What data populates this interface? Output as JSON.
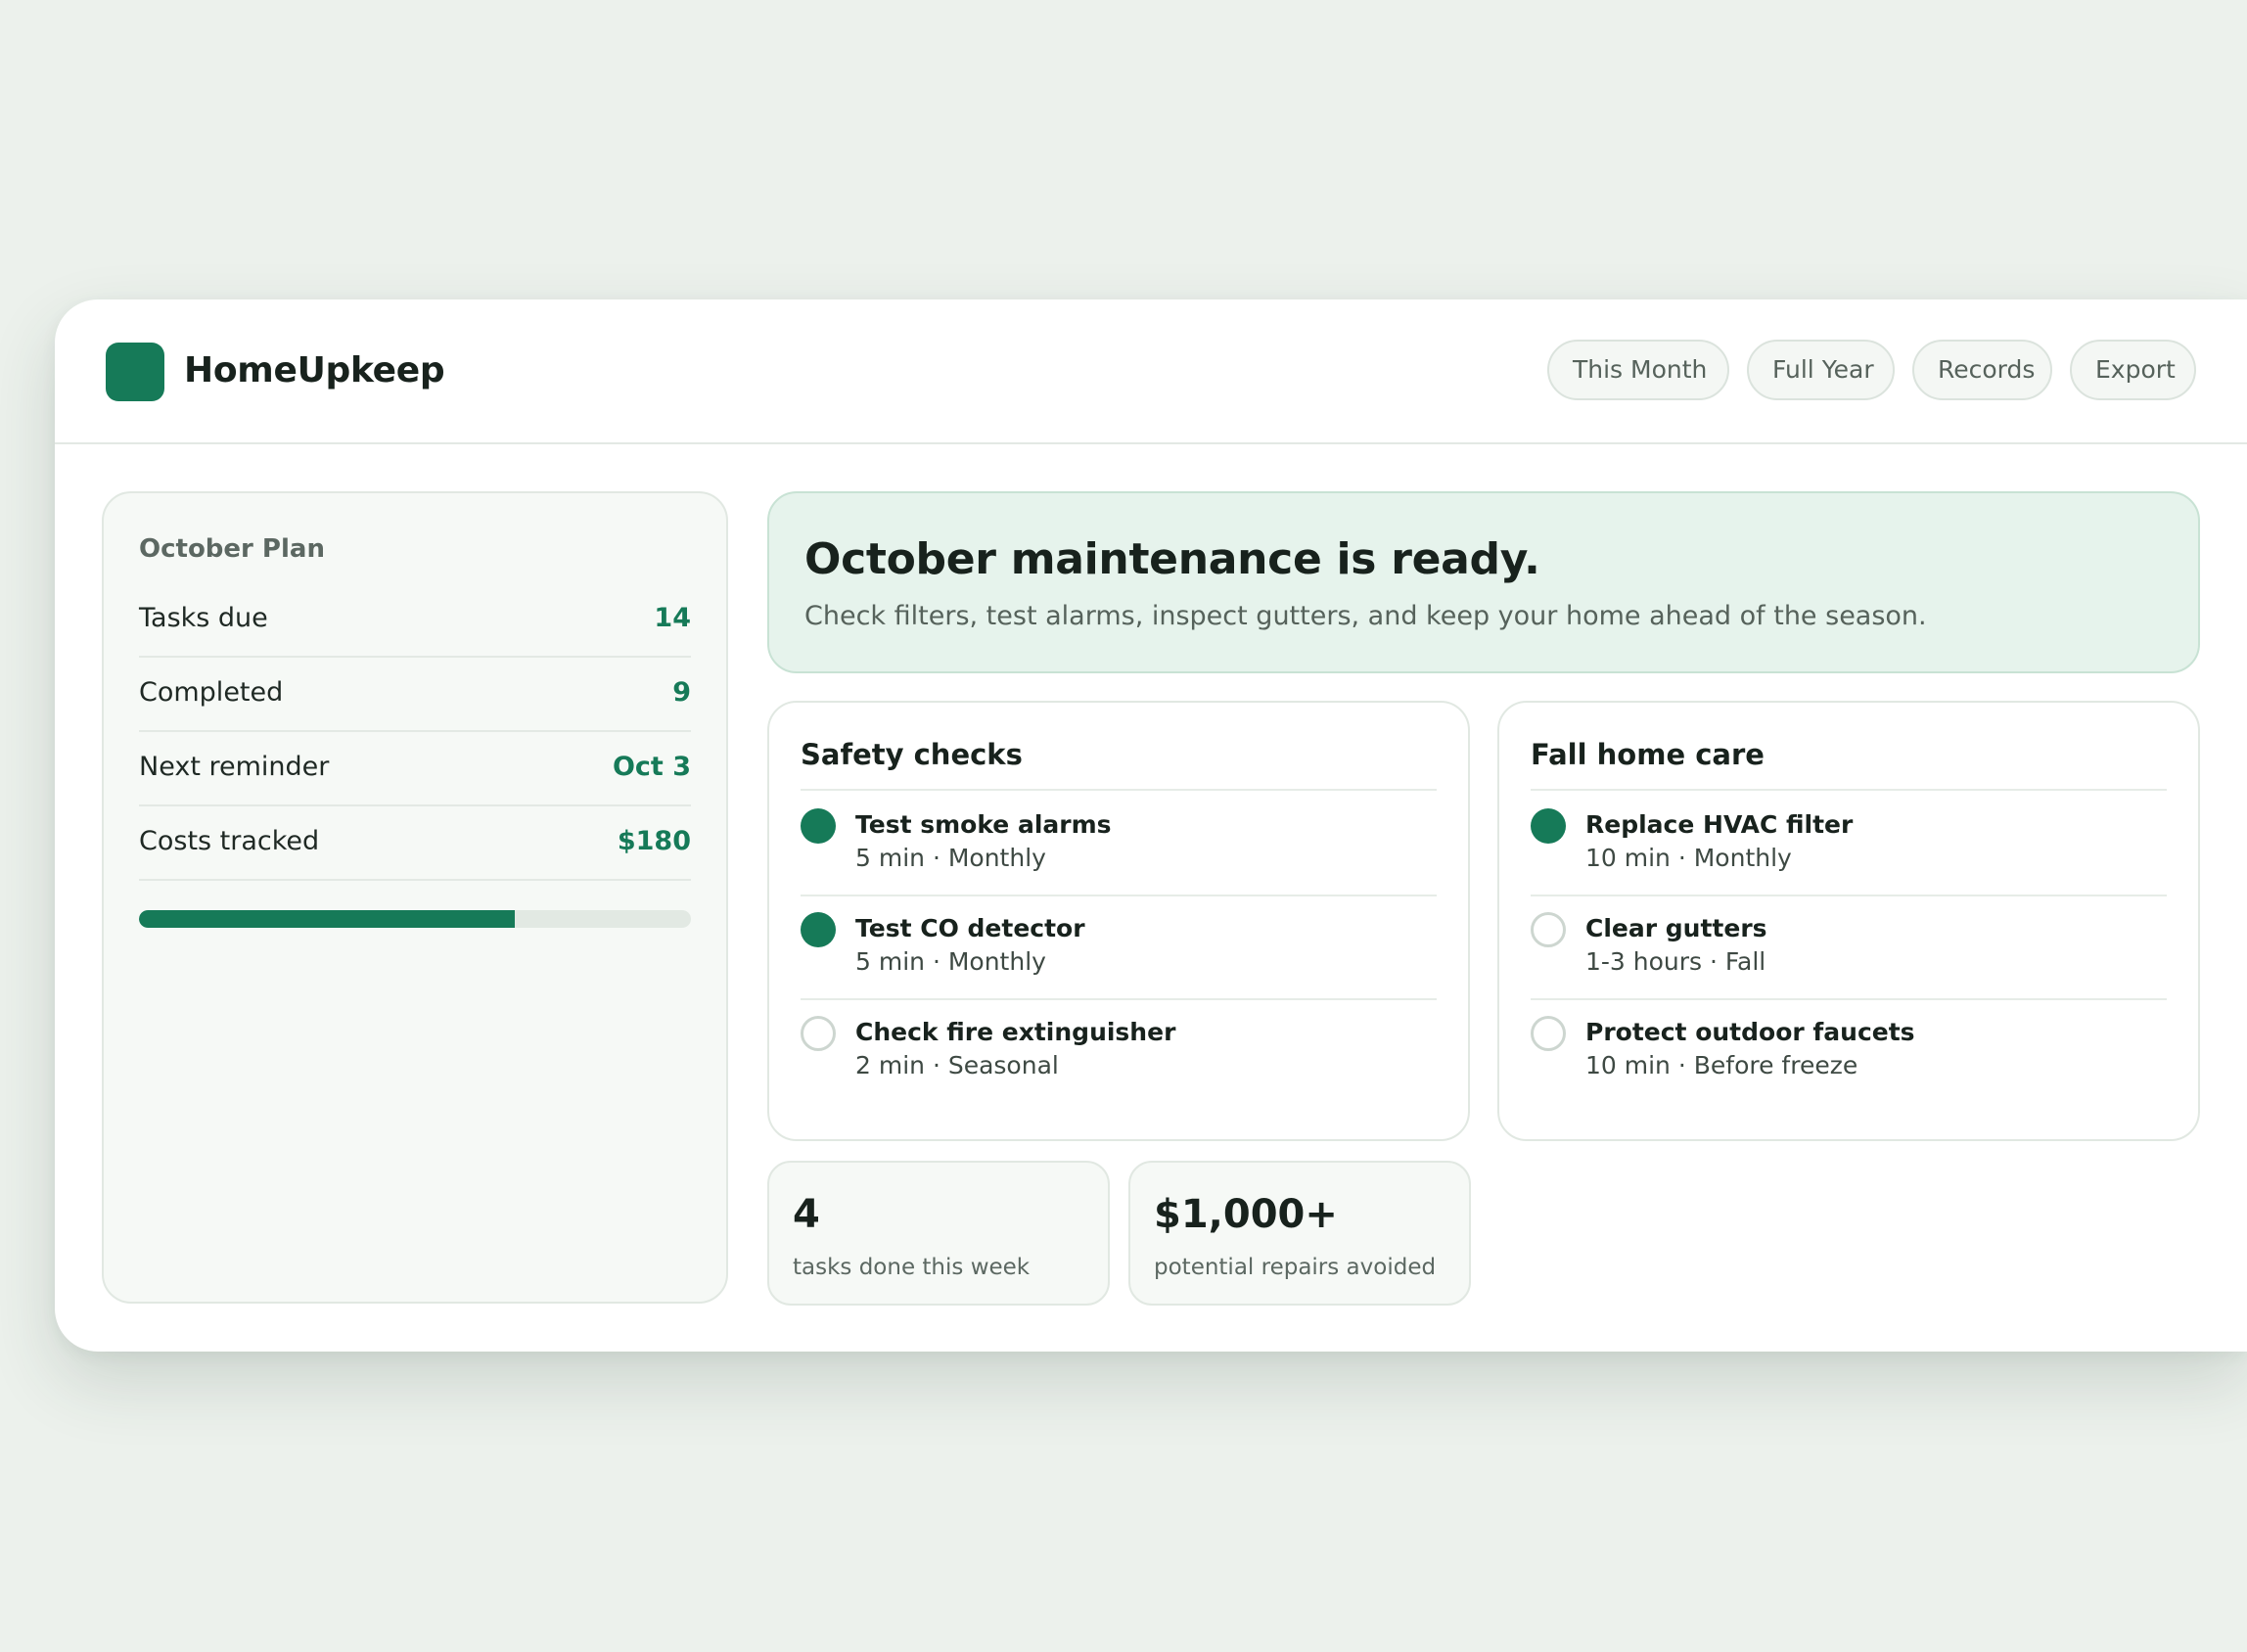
{
  "header": {
    "brand": "HomeUpkeep",
    "nav": [
      "This Month",
      "Full Year",
      "Records",
      "Export"
    ]
  },
  "plan": {
    "title": "October Plan",
    "rows": [
      {
        "label": "Tasks due",
        "value": "14"
      },
      {
        "label": "Completed",
        "value": "9"
      },
      {
        "label": "Next reminder",
        "value": "Oct 3"
      },
      {
        "label": "Costs tracked",
        "value": "$180"
      }
    ],
    "progress_fraction": 0.68
  },
  "hero": {
    "title": "October maintenance is ready.",
    "subtitle": "Check filters, test alarms, inspect gutters, and keep your home ahead of the season."
  },
  "cards": [
    {
      "title": "Safety checks",
      "tasks": [
        {
          "name": "Test smoke alarms",
          "meta": "5 min · Monthly",
          "done": true
        },
        {
          "name": "Test CO detector",
          "meta": "5 min · Monthly",
          "done": true
        },
        {
          "name": "Check fire extinguisher",
          "meta": "2 min · Seasonal",
          "done": false
        }
      ]
    },
    {
      "title": "Fall home care",
      "tasks": [
        {
          "name": "Replace HVAC filter",
          "meta": "10 min · Monthly",
          "done": true
        },
        {
          "name": "Clear gutters",
          "meta": "1-3 hours · Fall",
          "done": false
        },
        {
          "name": "Protect outdoor faucets",
          "meta": "10 min · Before freeze",
          "done": false
        }
      ]
    }
  ],
  "stats": [
    {
      "value": "4",
      "label": "tasks done this week"
    },
    {
      "value": "$1,000+",
      "label": "potential repairs avoided"
    }
  ],
  "colors": {
    "accent": "#167a58",
    "background": "#ecf1ec",
    "hero_bg": "#e6f3ec"
  }
}
